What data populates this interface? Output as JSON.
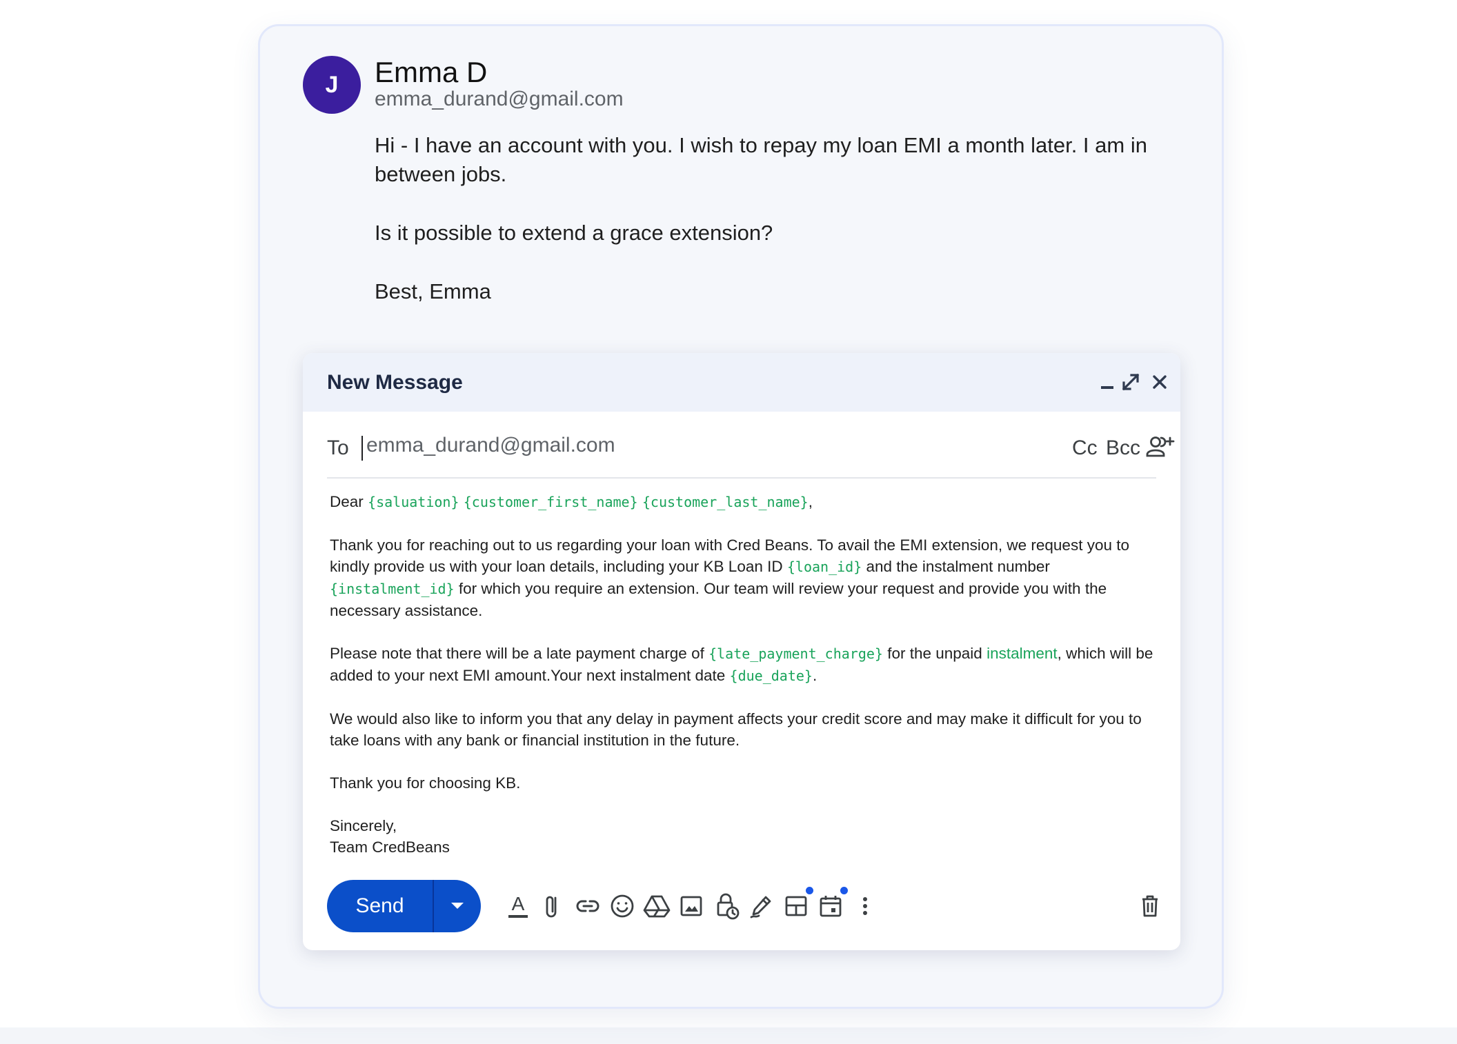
{
  "thread": {
    "sender": {
      "avatar_initial": "J",
      "avatar_color": "#3b1e9e",
      "name": "Emma D",
      "email": "emma_durand@gmail.com"
    },
    "message": [
      "Hi - I have an account with you. I wish to repay my loan EMI a month later. I am in between jobs.",
      "Is it possible to extend a grace extension?",
      "Best, Emma"
    ]
  },
  "compose": {
    "title": "New Message",
    "to_label": "To",
    "to_value": "emma_durand@gmail.com",
    "cc_label": "Cc",
    "bcc_label": "Bcc",
    "body": {
      "greeting_prefix": "Dear ",
      "salutation_var": "{saluation}",
      "first_name_var": "{customer_first_name}",
      "last_name_var": "{customer_last_name}",
      "greeting_suffix": ",",
      "p1_a": "Thank you for reaching out to us regarding your loan with Cred Beans. To avail the EMI extension, we request you to kindly provide us with your loan details, including your KB Loan ID ",
      "loan_id_var": "{loan_id}",
      "p1_b": " and the instalment number ",
      "instalment_id_var": "{instalment_id}",
      "p1_c": " for which you require an extension. Our team will review your request and provide you with the necessary assistance.",
      "p2_a": "Please note that there will be a late payment charge of ",
      "late_charge_var": "{late_payment_charge}",
      "p2_b": " for the unpaid ",
      "p2_highlight": "instalment",
      "p2_c": ", which will be added to your next EMI amount.Your next instalment date ",
      "due_date_var": "{due_date}",
      "p2_d": ".",
      "p3": "We would also like to inform you that any delay in payment affects your credit score and may make it difficult for you to take loans with any bank or financial institution in the future.",
      "p4": "Thank you for choosing KB.",
      "closing": "Sincerely,",
      "signature": "Team CredBeans"
    },
    "send_label": "Send",
    "toolbar_icons": [
      "format-text-icon",
      "attach-icon",
      "link-icon",
      "emoji-icon",
      "drive-icon",
      "image-icon",
      "confidential-icon",
      "signature-icon",
      "layout-icon",
      "schedule-icon",
      "more-options-icon",
      "delete-icon"
    ],
    "accent_color": "#0b4fc9",
    "placeholder_color": "#19a35a",
    "notification_dot_color": "#1a57e8"
  }
}
